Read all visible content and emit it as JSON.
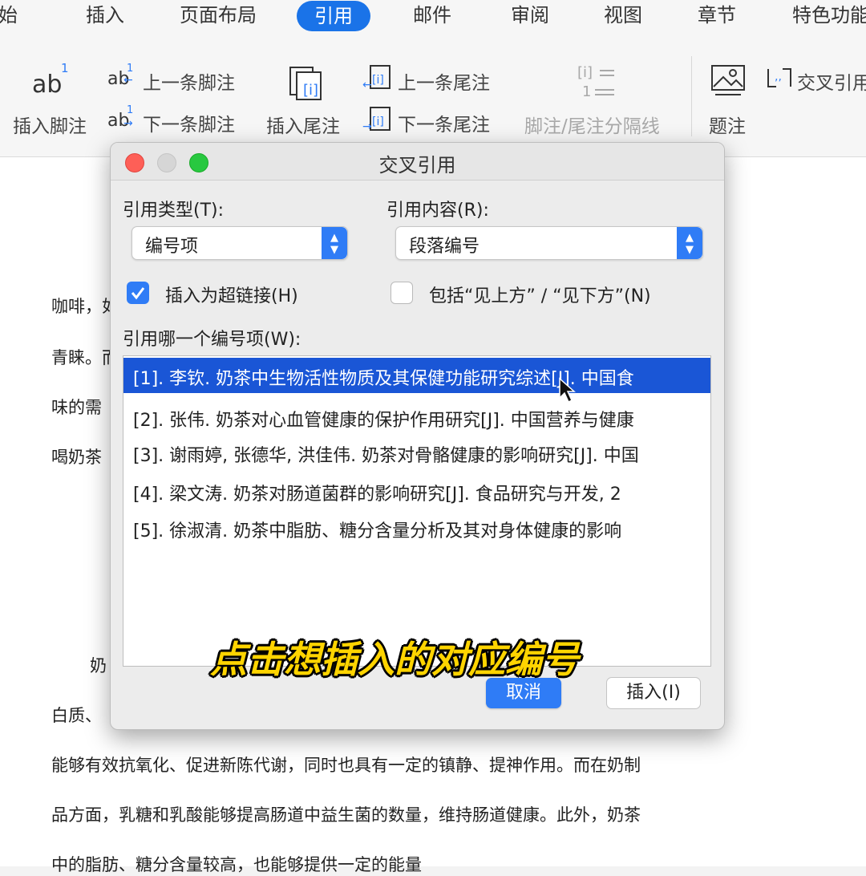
{
  "tabs": [
    "开始",
    "插入",
    "页面布局",
    "引用",
    "邮件",
    "审阅",
    "视图",
    "章节",
    "特色功能"
  ],
  "active_tab": "引用",
  "ribbon": {
    "insert_footnote": "插入脚注",
    "prev_footnote": "上一条脚注",
    "next_footnote": "下一条脚注",
    "insert_endnote": "插入尾注",
    "prev_endnote": "上一条尾注",
    "next_endnote": "下一条尾注",
    "separator": "脚注/尾注分隔线",
    "caption": "题注",
    "cross_ref": "交叉引用",
    "ab_label": "ab",
    "ab_sup": "1"
  },
  "doc_fragments": {
    "l1": "咖啡，如",
    "l2": "青睐。而",
    "l3": "味的需",
    "l4": "喝奶茶",
    "l5": "奶",
    "l6": "白质、",
    "l7": "能够有效抗氧化、促进新陈代谢，同时也具有一定的镇静、提神作用。而在奶制",
    "l8": "品方面，乳糖和乳酸能够提高肠道中益生菌的数量，维持肠道健康。此外，奶茶",
    "l9": "中的脂肪、糖分含量较高，也能够提供一定的能量"
  },
  "dialog": {
    "title": "交叉引用",
    "ref_type_label": "引用类型(T):",
    "ref_type_value": "编号项",
    "ref_content_label": "引用内容(R):",
    "ref_content_value": "段落编号",
    "hyperlink_label": "插入为超链接(H)",
    "hyperlink_checked": true,
    "above_below_label": "包括“见上方” / “见下方”(N)",
    "above_below_checked": false,
    "list_label": "引用哪一个编号项(W):",
    "items": [
      "[1]. 李钦. 奶茶中生物活性物质及其保健功能研究综述[J]. 中国食",
      "[2]. 张伟. 奶茶对心血管健康的保护作用研究[J]. 中国营养与健康",
      "[3]. 谢雨婷, 张德华, 洪佳伟. 奶茶对骨骼健康的影响研究[J]. 中国",
      "[4]. 梁文涛. 奶茶对肠道菌群的影响研究[J]. 食品研究与开发, 2",
      "[5]. 徐淑清. 奶茶中脂肪、糖分含量分析及其对身体健康的影响"
    ],
    "selected_index": 0,
    "cancel_label": "取消",
    "insert_label": "插入(I)"
  },
  "subtitle": "点击想插入的对应编号",
  "colors": {
    "accent": "#2f7cf6",
    "selection": "#1a56d6",
    "subtitle": "#ffd400",
    "traffic_red": "#fe5f57",
    "traffic_green": "#28c840"
  },
  "icons": [
    "footnote-icon",
    "prev-footnote-icon",
    "next-footnote-icon",
    "endnote-icon",
    "prev-endnote-icon",
    "next-endnote-icon",
    "separator-icon",
    "caption-icon",
    "cross-ref-icon",
    "chevron-updown-icon",
    "checkmark-icon",
    "cursor-icon"
  ]
}
